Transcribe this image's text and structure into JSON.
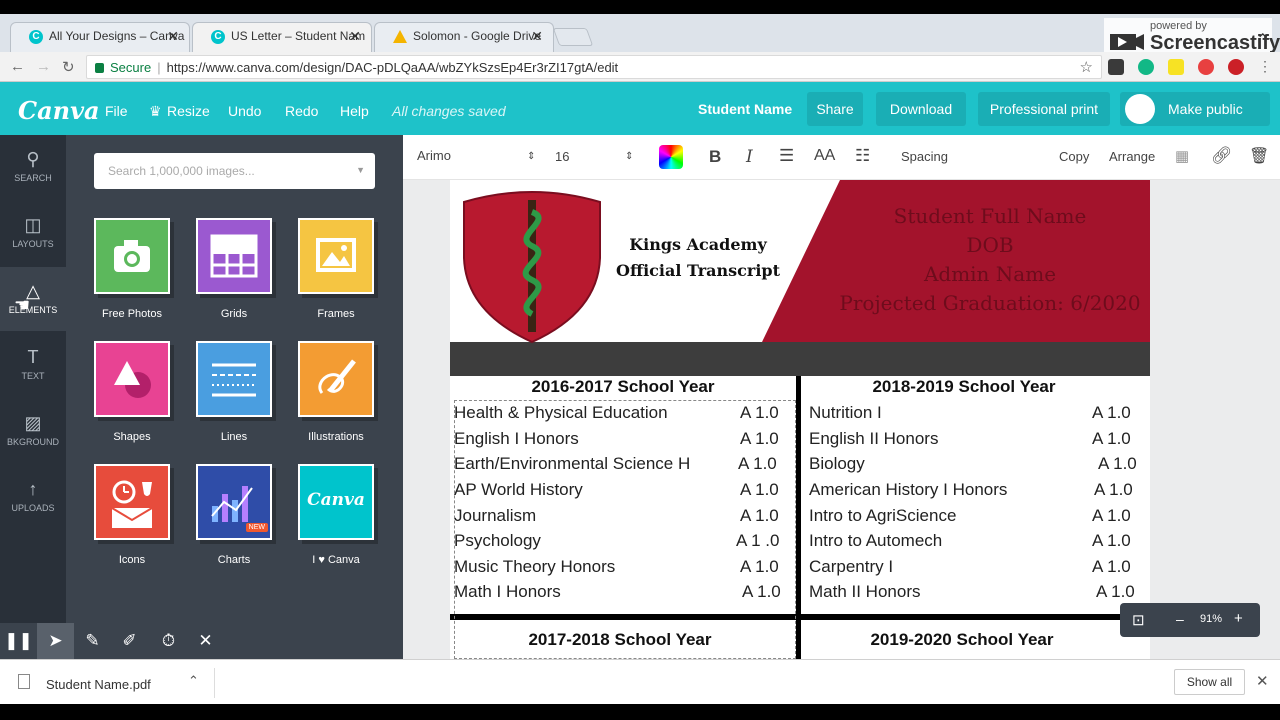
{
  "browser": {
    "tabs": [
      {
        "label": "All Your Designs – Canva",
        "close": "✕"
      },
      {
        "label": "US Letter – Student Nam",
        "close": "✕"
      },
      {
        "label": "Solomon - Google Drive",
        "close": "✕"
      }
    ],
    "address": {
      "secure_label": "Secure",
      "url": "https://www.canva.com/design/DAC-pDLQaAA/wbZYkSzsEp4Er3rZI17gtA/edit"
    },
    "castify": {
      "powered_by": "powered by",
      "brand": "Screencastify"
    }
  },
  "canva": {
    "logo": "Canva",
    "menu": {
      "file": "File",
      "resize": "Resize",
      "undo": "Undo",
      "redo": "Redo",
      "help": "Help",
      "status": "All changes saved"
    },
    "design_name": "Student Name",
    "buttons": {
      "share": "Share",
      "download": "Download",
      "print": "Professional print",
      "public": "Make public"
    },
    "sidebar": [
      {
        "label": "SEARCH",
        "icon": "search-icon"
      },
      {
        "label": "LAYOUTS",
        "icon": "layouts-icon"
      },
      {
        "label": "ELEMENTS",
        "icon": "elements-icon"
      },
      {
        "label": "TEXT",
        "icon": "text-icon"
      },
      {
        "label": "BKGROUND",
        "icon": "background-icon"
      },
      {
        "label": "UPLOADS",
        "icon": "upload-icon"
      }
    ],
    "panel": {
      "search_placeholder": "Search 1,000,000 images...",
      "tiles": [
        {
          "label": "Free Photos",
          "color": "#5cb85c"
        },
        {
          "label": "Grids",
          "color": "#9b59d0"
        },
        {
          "label": "Frames",
          "color": "#f5c542"
        },
        {
          "label": "Shapes",
          "color": "#e84393"
        },
        {
          "label": "Lines",
          "color": "#4a9ee0"
        },
        {
          "label": "Illustrations",
          "color": "#f39c33"
        },
        {
          "label": "Icons",
          "color": "#e74c3c"
        },
        {
          "label": "Charts",
          "color": "#2f4da8",
          "badge": "NEW"
        },
        {
          "label": "I ♥ Canva",
          "color": "#00c4cc",
          "logo": "Canva"
        }
      ]
    },
    "toolbar": {
      "font": "Arimo",
      "size": "16",
      "bold": "B",
      "italic": "I",
      "case": "AA",
      "spacing": "Spacing",
      "copy": "Copy",
      "arrange": "Arrange"
    },
    "zoom": {
      "minus": "–",
      "level": "91%",
      "plus": "+"
    }
  },
  "document": {
    "school_name": "Kings Academy",
    "doc_type": "Official Transcript",
    "student_info": [
      "Student Full Name",
      "DOB",
      "Admin Name",
      "Projected Graduation: 6/2020"
    ],
    "years": [
      {
        "title": "2016-2017 School Year",
        "courses": [
          {
            "name": "Health & Physical Education",
            "grade": "A  1.0"
          },
          {
            "name": "English I Honors",
            "grade": "A  1.0"
          },
          {
            "name": "Earth/Environmental Science H",
            "grade": "A  1.0"
          },
          {
            "name": "AP World History",
            "grade": "A  1.0"
          },
          {
            "name": "Journalism",
            "grade": "A  1.0"
          },
          {
            "name": "Psychology",
            "grade": "A  1 .0"
          },
          {
            "name": "Music Theory Honors",
            "grade": "A  1.0"
          },
          {
            "name": "Math I Honors",
            "grade": "A 1.0"
          }
        ]
      },
      {
        "title": "2018-2019 School Year",
        "courses": [
          {
            "name": "Nutrition I",
            "grade": "A  1.0"
          },
          {
            "name": "English II Honors",
            "grade": "A  1.0"
          },
          {
            "name": "Biology",
            "grade": "A  1.0"
          },
          {
            "name": "American History I Honors",
            "grade": "A  1.0"
          },
          {
            "name": "Intro to AgriScience",
            "grade": "A  1.0"
          },
          {
            "name": "Intro to Automech",
            "grade": "A  1.0"
          },
          {
            "name": "Carpentry I",
            "grade": "A  1.0"
          },
          {
            "name": "Math II Honors",
            "grade": "A 1.0"
          }
        ]
      },
      {
        "title": "2017-2018 School Year"
      },
      {
        "title": "2019-2020 School Year"
      }
    ]
  },
  "downloads": {
    "file": "Student Name.pdf",
    "show_all": "Show all"
  }
}
